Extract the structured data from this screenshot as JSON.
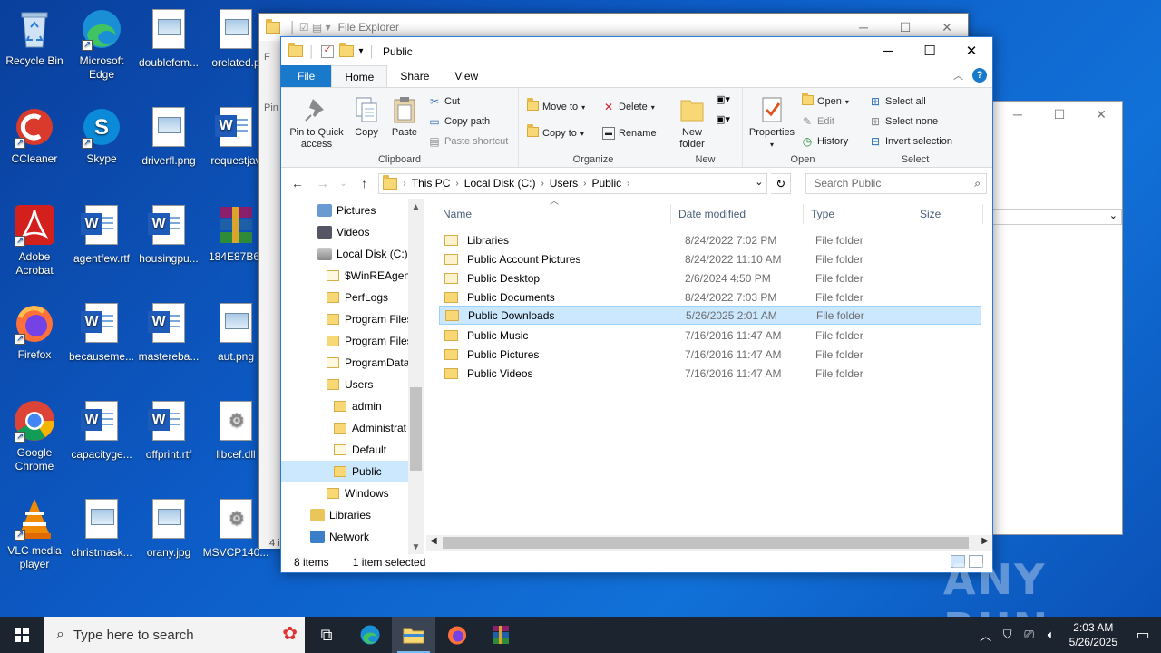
{
  "desktop": {
    "icons": [
      {
        "label": "Recycle Bin"
      },
      {
        "label": "Microsoft Edge"
      },
      {
        "label": "doublefem..."
      },
      {
        "label": "orelated.p"
      },
      {
        "label": "CCleaner"
      },
      {
        "label": "Skype"
      },
      {
        "label": "driverfl.png"
      },
      {
        "label": "requestjav"
      },
      {
        "label": "Adobe Acrobat"
      },
      {
        "label": "agentfew.rtf"
      },
      {
        "label": "housingpu..."
      },
      {
        "label": "184E87B6-"
      },
      {
        "label": "Firefox"
      },
      {
        "label": "becauseme..."
      },
      {
        "label": "mastereba..."
      },
      {
        "label": "aut.png"
      },
      {
        "label": "Google Chrome"
      },
      {
        "label": "capacityge..."
      },
      {
        "label": "offprint.rtf"
      },
      {
        "label": "libcef.dll"
      },
      {
        "label": "VLC media player"
      },
      {
        "label": "christmask..."
      },
      {
        "label": "orany.jpg"
      },
      {
        "label": "MSVCP140..."
      }
    ]
  },
  "bg_window": {
    "title": "File Explorer",
    "side_text_1": "Pin",
    "side_text_2": "F",
    "status_fragment": "4 i"
  },
  "window": {
    "title": "Public",
    "tabs": {
      "file": "File",
      "home": "Home",
      "share": "Share",
      "view": "View"
    },
    "ribbon": {
      "clipboard": {
        "name": "Clipboard",
        "pin": "Pin to Quick access",
        "copy": "Copy",
        "paste": "Paste",
        "cut": "Cut",
        "copy_path": "Copy path",
        "paste_shortcut": "Paste shortcut"
      },
      "organize": {
        "name": "Organize",
        "move_to": "Move to",
        "copy_to": "Copy to",
        "delete": "Delete",
        "rename": "Rename"
      },
      "new": {
        "name": "New",
        "new_folder": "New folder"
      },
      "open": {
        "name": "Open",
        "properties": "Properties",
        "open": "Open",
        "edit": "Edit",
        "history": "History"
      },
      "select": {
        "name": "Select",
        "select_all": "Select all",
        "select_none": "Select none",
        "invert": "Invert selection"
      }
    },
    "address": {
      "path": [
        "This PC",
        "Local Disk (C:)",
        "Users",
        "Public"
      ],
      "search_placeholder": "Search Public"
    },
    "nav_pane": [
      {
        "label": "Pictures"
      },
      {
        "label": "Videos"
      },
      {
        "label": "Local Disk (C:)"
      },
      {
        "label": "$WinREAgent"
      },
      {
        "label": "PerfLogs"
      },
      {
        "label": "Program Files"
      },
      {
        "label": "Program Files"
      },
      {
        "label": "ProgramData"
      },
      {
        "label": "Users"
      },
      {
        "label": "admin"
      },
      {
        "label": "Administrat"
      },
      {
        "label": "Default"
      },
      {
        "label": "Public"
      },
      {
        "label": "Windows"
      },
      {
        "label": "Libraries"
      },
      {
        "label": "Network"
      }
    ],
    "columns": {
      "name": "Name",
      "date": "Date modified",
      "type": "Type",
      "size": "Size"
    },
    "files": [
      {
        "name": "Libraries",
        "date": "8/24/2022 7:02 PM",
        "type": "File folder"
      },
      {
        "name": "Public Account Pictures",
        "date": "8/24/2022 11:10 AM",
        "type": "File folder"
      },
      {
        "name": "Public Desktop",
        "date": "2/6/2024 4:50 PM",
        "type": "File folder"
      },
      {
        "name": "Public Documents",
        "date": "8/24/2022 7:03 PM",
        "type": "File folder"
      },
      {
        "name": "Public Downloads",
        "date": "5/26/2025 2:01 AM",
        "type": "File folder"
      },
      {
        "name": "Public Music",
        "date": "7/16/2016 11:47 AM",
        "type": "File folder"
      },
      {
        "name": "Public Pictures",
        "date": "7/16/2016 11:47 AM",
        "type": "File folder"
      },
      {
        "name": "Public Videos",
        "date": "7/16/2016 11:47 AM",
        "type": "File folder"
      }
    ],
    "status": {
      "count": "8 items",
      "selection": "1 item selected"
    }
  },
  "taskbar": {
    "search_placeholder": "Type here to search",
    "time": "2:03 AM",
    "date": "5/26/2025"
  },
  "watermark": "ANY RUN"
}
